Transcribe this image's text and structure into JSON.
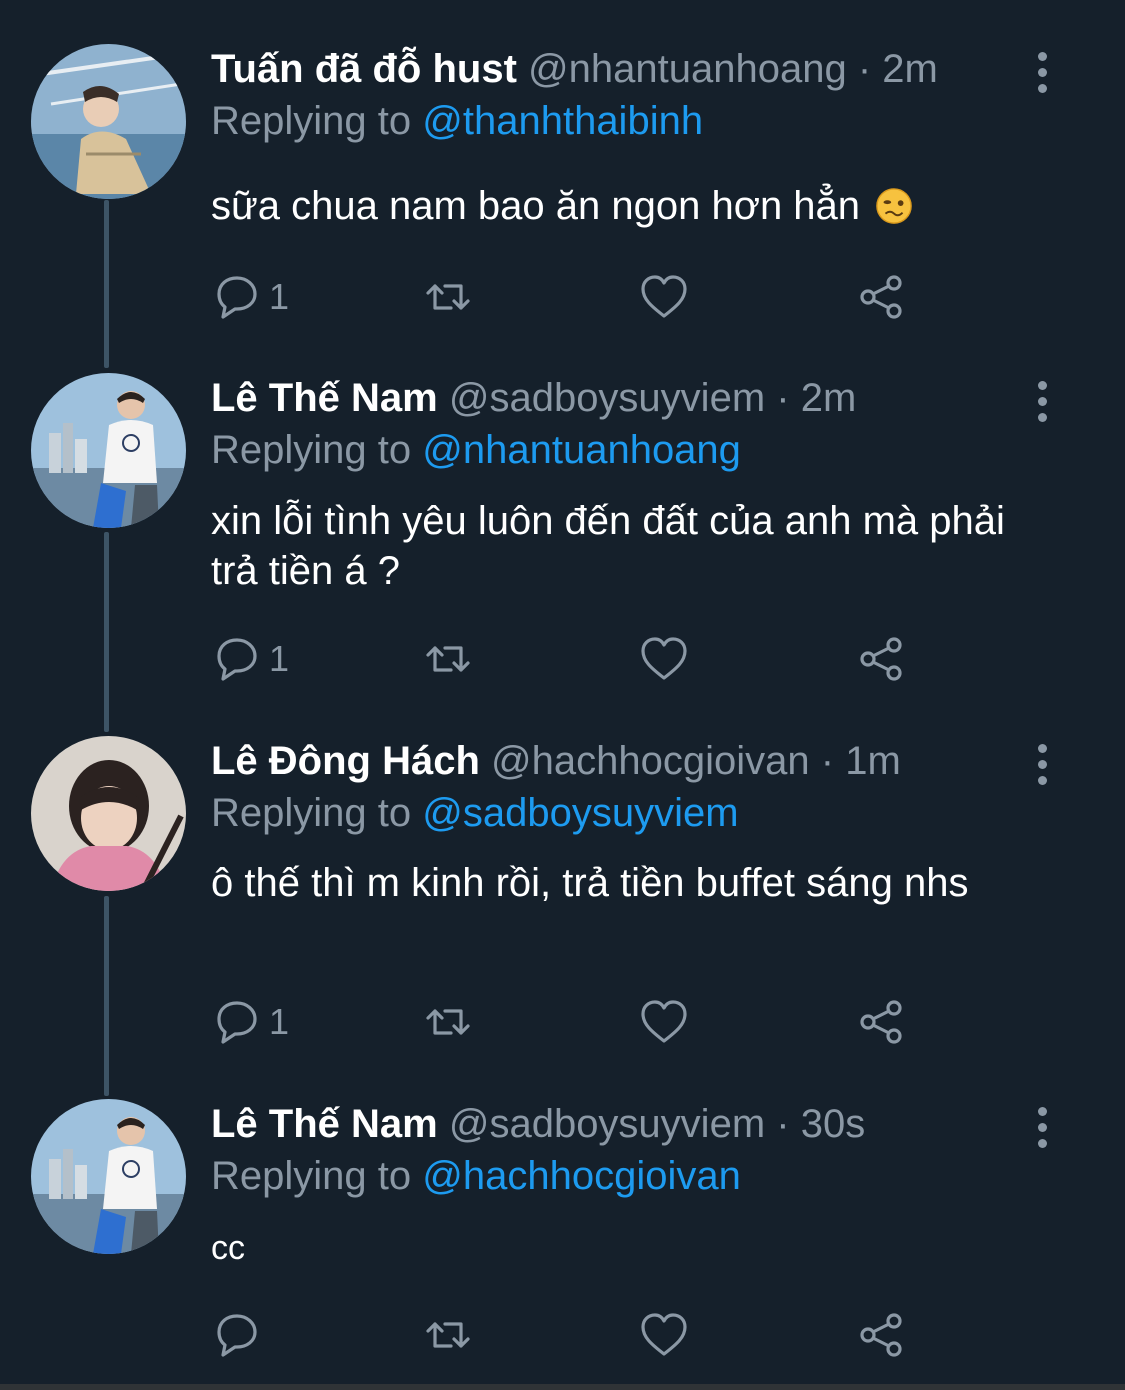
{
  "tweets": [
    {
      "name": "Tuấn đã đỗ hust",
      "handle": "@nhantuanhoang",
      "sep": "·",
      "time": "2m",
      "reply_prefix": "Replying to",
      "reply_to": "@thanhthaibinh",
      "text": "sữa chua nam bao ăn ngon hơn hẳn",
      "text_emoji": "woozy-face",
      "reply_count": "1",
      "avatar": "person-on-boat-photo"
    },
    {
      "name": "Lê Thế Nam",
      "handle": "@sadboysuyviem",
      "sep": "·",
      "time": "2m",
      "reply_prefix": "Replying to",
      "reply_to": "@nhantuanhoang",
      "text": "xin lỗi tình yêu luôn đến đất của anh mà phải trả tiền á ?",
      "reply_count": "1",
      "avatar": "person-in-white-shirt-photo"
    },
    {
      "name": "Lê Đông Hách",
      "handle": "@hachhocgioivan",
      "sep": "·",
      "time": "1m",
      "reply_prefix": "Replying to",
      "reply_to": "@sadboysuyviem",
      "text": "ô thế thì m kinh rồi, trả tiền buffet sáng nhs",
      "reply_count": "1",
      "avatar": "person-pink-hoodie-photo"
    },
    {
      "name": "Lê Thế Nam",
      "handle": "@sadboysuyviem",
      "sep": "·",
      "time": "30s",
      "reply_prefix": "Replying to",
      "reply_to": "@hachhocgioivan",
      "text": "cc",
      "reply_count": "",
      "avatar": "person-in-white-shirt-photo"
    }
  ],
  "colors": {
    "background": "#15202b",
    "secondary_text": "#8b98a5",
    "mention": "#1d9bf0",
    "thread_line": "#3d5466"
  },
  "icons": [
    "reply-icon",
    "retweet-icon",
    "like-icon",
    "share-icon",
    "more-icon"
  ]
}
